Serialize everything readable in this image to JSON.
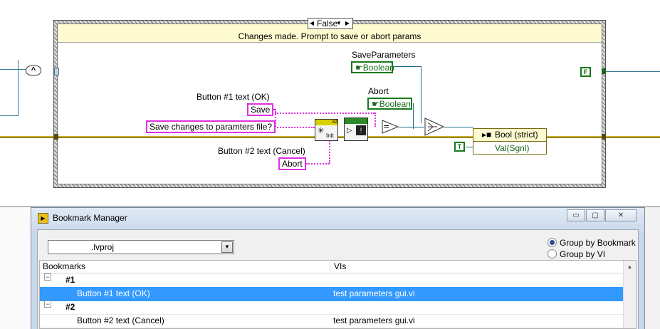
{
  "diagram": {
    "case_selector_value": "False",
    "case_label": "Changes made. Prompt to save or abort params",
    "and_node": "^",
    "save_params_label": "SaveParameters",
    "save_params_type": "Boolean",
    "abort_label": "Abort",
    "abort_type": "Boolean",
    "btn1_label": "Button #1 text (OK)",
    "btn1_const": "Save",
    "message_const": "Save changes to paramters file?",
    "btn2_label": "Button #2 text (Cancel)",
    "btn2_const": "Abort",
    "init_label": "Init",
    "unbundle_row1": "Bool (strict)",
    "unbundle_row2": "Val(Sgnl)",
    "false_const": "F",
    "true_const": "T",
    "dialog_badge": "x2",
    "equals_symbol": "="
  },
  "window": {
    "title": "Bookmark Manager",
    "project_select": ".lvproj",
    "group_by_bookmark": "Group by Bookmark",
    "group_by_vi": "Group by VI",
    "columns": {
      "bookmarks": "Bookmarks",
      "vis": "VIs"
    },
    "rows": [
      {
        "bookmark": "#1",
        "vi": ""
      },
      {
        "bookmark": "Button #1 text (OK)",
        "vi": "test parameters gui.vi"
      },
      {
        "bookmark": "#2",
        "vi": ""
      },
      {
        "bookmark": "Button #2 text (Cancel)",
        "vi": "test parameters gui.vi"
      }
    ]
  },
  "colors": {
    "string_wire": "#e030e0",
    "bool_wire": "#1a7a1a",
    "cluster_wire": "#8b6d1a",
    "selection": "#3399ff"
  }
}
